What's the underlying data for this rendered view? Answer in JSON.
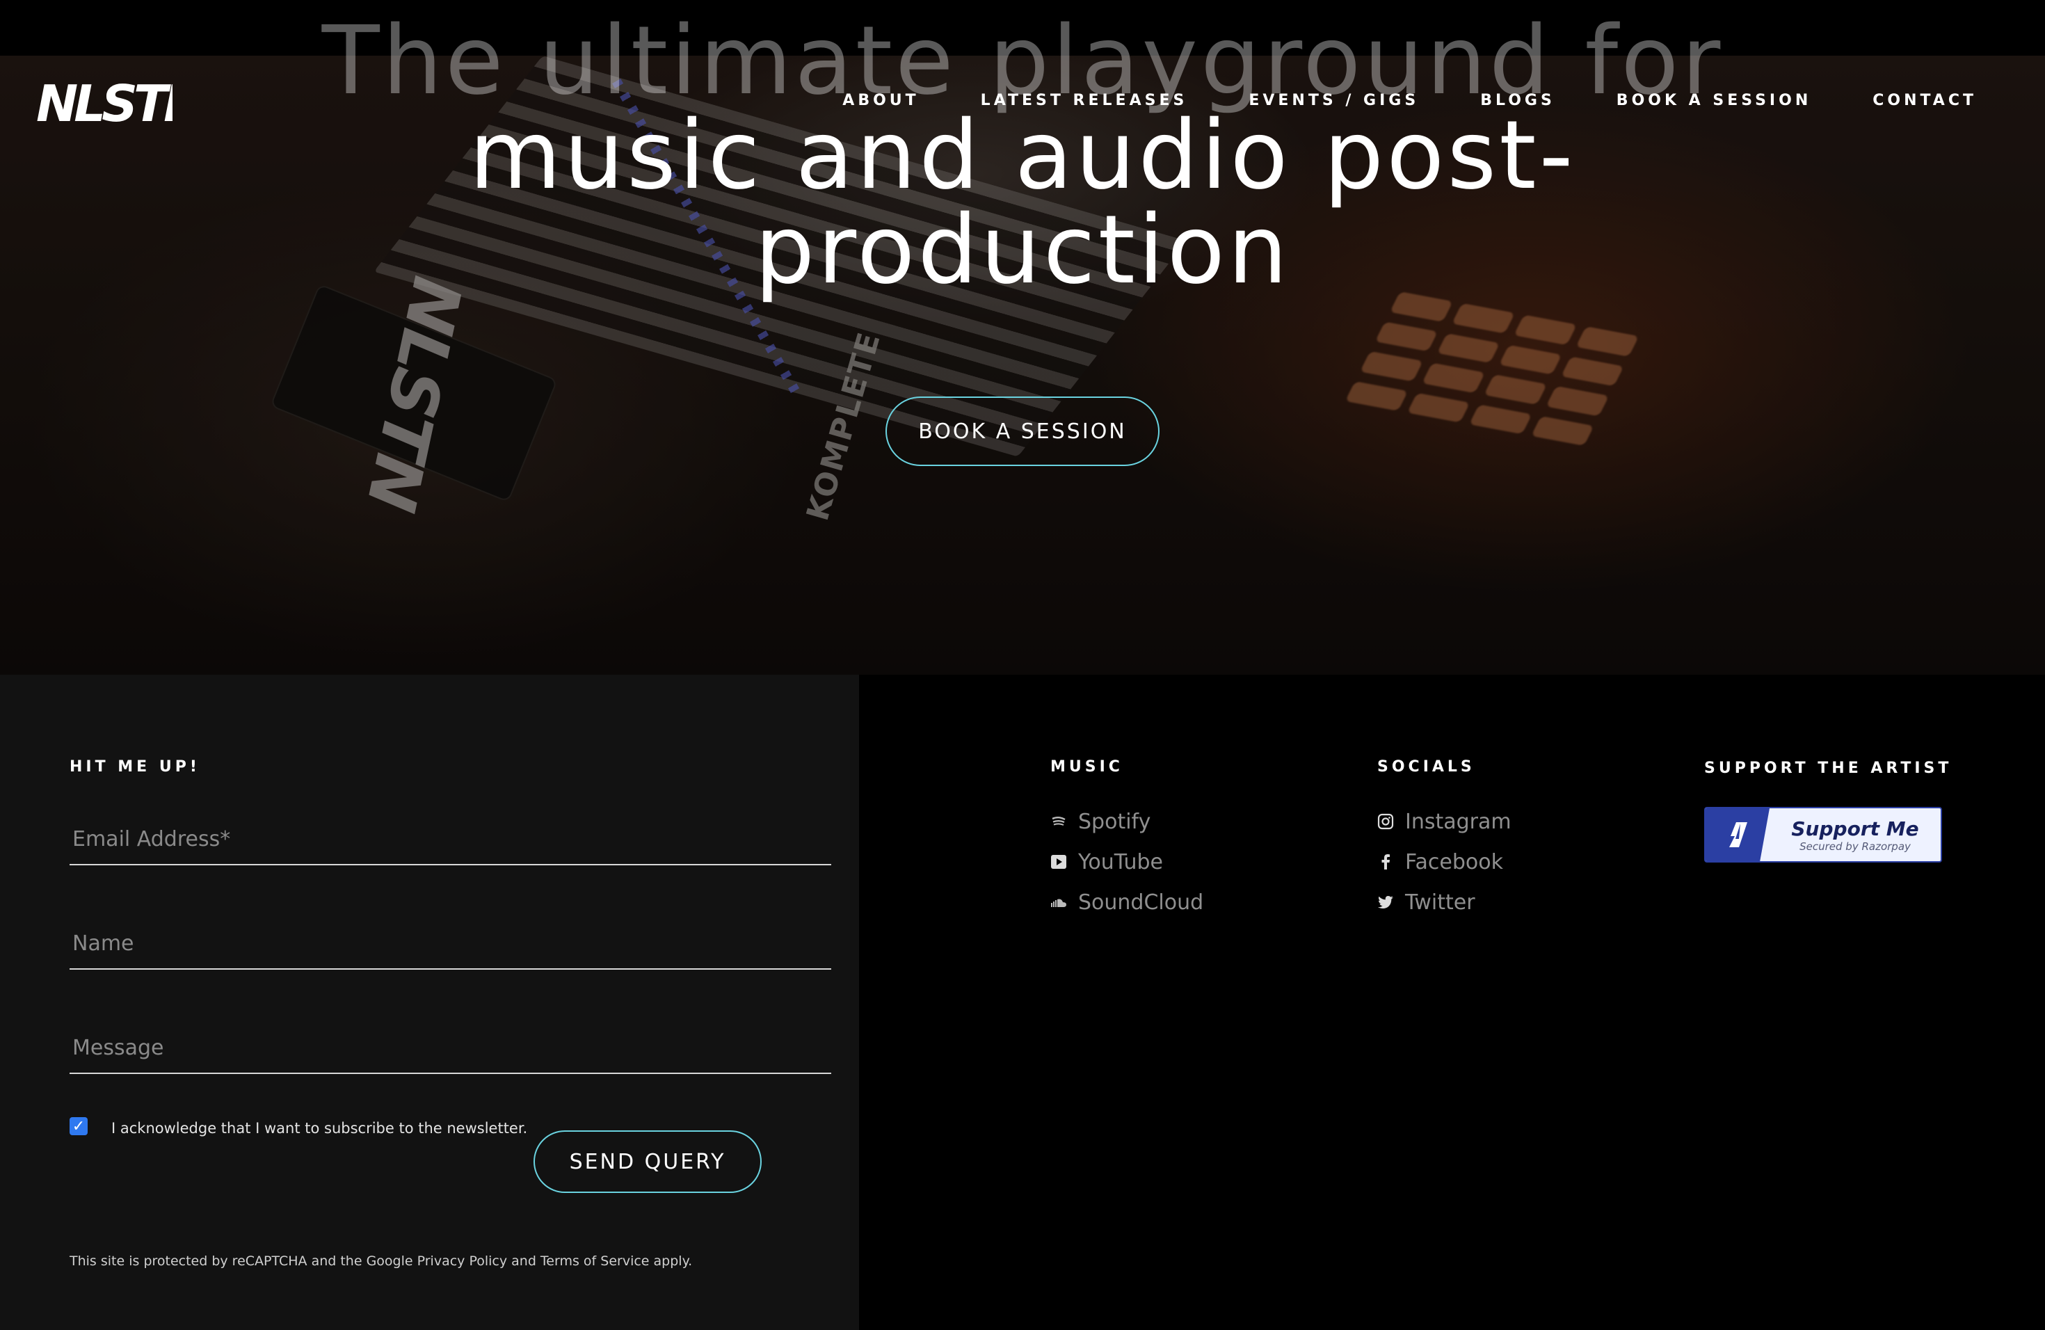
{
  "nav": {
    "logo_text": "NLSTN",
    "items": [
      {
        "label": "ABOUT"
      },
      {
        "label": "LATEST RELEASES"
      },
      {
        "label": "EVENTS / GIGS"
      },
      {
        "label": "BLOGS"
      },
      {
        "label": "BOOK A SESSION"
      },
      {
        "label": "CONTACT"
      }
    ]
  },
  "hero": {
    "title_faded": "The ultimate playground for",
    "title_line1": "music and audio post-",
    "title_line2": "production",
    "cta_label": "BOOK A SESSION",
    "background_logo_text": "NLSTN",
    "background_brand_text": "KOMPLETE"
  },
  "contact": {
    "heading": "HIT ME UP!",
    "email_placeholder": "Email Address*",
    "name_placeholder": "Name",
    "message_placeholder": "Message",
    "newsletter_checked": true,
    "newsletter_label": "I acknowledge that I want to subscribe to the newsletter.",
    "send_label": "SEND QUERY",
    "recaptcha_text": "This site is protected by reCAPTCHA and the Google Privacy Policy and Terms of Service apply."
  },
  "music": {
    "heading": "MUSIC",
    "links": [
      {
        "label": "Spotify",
        "icon": "spotify-icon"
      },
      {
        "label": "YouTube",
        "icon": "youtube-icon"
      },
      {
        "label": "SoundCloud",
        "icon": "soundcloud-icon"
      }
    ]
  },
  "socials": {
    "heading": "SOCIALS",
    "links": [
      {
        "label": "Instagram",
        "icon": "instagram-icon"
      },
      {
        "label": "Facebook",
        "icon": "facebook-icon"
      },
      {
        "label": "Twitter",
        "icon": "twitter-icon"
      }
    ]
  },
  "support": {
    "heading": "SUPPORT THE ARTIST",
    "button_label": "Support Me",
    "button_sub": "Secured by Razorpay"
  },
  "colors": {
    "accent_outline": "#6ad3e0",
    "checkbox": "#2f79f0",
    "razorpay_blue": "#2b3fa3",
    "contact_panel_bg": "#121212",
    "footer_bg": "#000000"
  }
}
